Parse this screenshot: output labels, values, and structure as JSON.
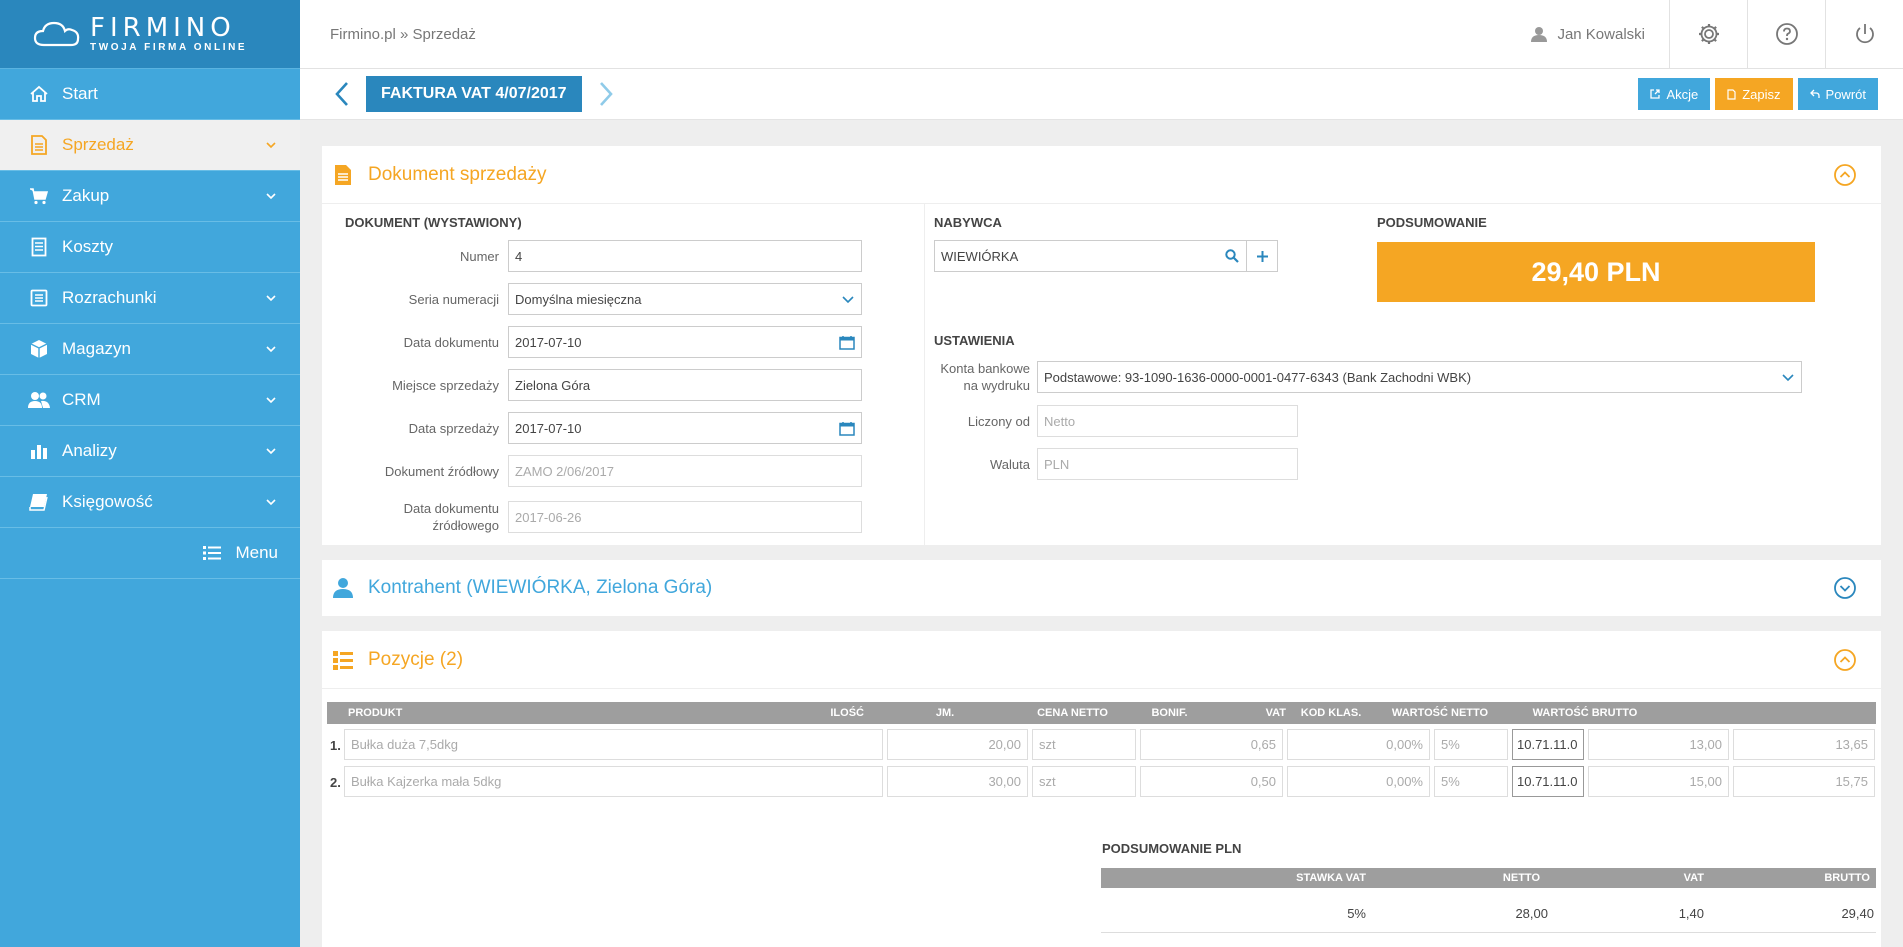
{
  "app": {
    "logo_name": "FIRMINO",
    "logo_tagline": "TWOJA FIRMA ONLINE"
  },
  "sidebar": {
    "items": [
      {
        "label": "Start",
        "icon": "home-icon"
      },
      {
        "label": "Sprzedaż",
        "icon": "document-icon",
        "active": true
      },
      {
        "label": "Zakup",
        "icon": "cart-icon"
      },
      {
        "label": "Koszty",
        "icon": "receipt-icon"
      },
      {
        "label": "Rozrachunki",
        "icon": "ledger-icon"
      },
      {
        "label": "Magazyn",
        "icon": "box-icon"
      },
      {
        "label": "CRM",
        "icon": "users-icon"
      },
      {
        "label": "Analizy",
        "icon": "bar-chart-icon"
      },
      {
        "label": "Księgowość",
        "icon": "book-icon"
      }
    ],
    "menu_label": "Menu"
  },
  "header": {
    "breadcrumb": "Firmino.pl » Sprzedaż",
    "user_name": "Jan Kowalski"
  },
  "titlebar": {
    "doc_title": "FAKTURA VAT 4/07/2017",
    "akcje": "Akcje",
    "zapisz": "Zapisz",
    "powrot": "Powrót"
  },
  "document_panel": {
    "title": "Dokument sprzedaży",
    "section_doc": "DOKUMENT (WYSTAWIONY)",
    "numer_label": "Numer",
    "numer_value": "4",
    "seria_label": "Seria numeracji",
    "seria_value": "Domyślna miesięczna",
    "data_dok_label": "Data dokumentu",
    "data_dok_value": "2017-07-10",
    "miejsce_label": "Miejsce sprzedaży",
    "miejsce_value": "Zielona Góra",
    "data_sprz_label": "Data sprzedaży",
    "data_sprz_value": "2017-07-10",
    "dok_zrodl_label": "Dokument źródłowy",
    "dok_zrodl_value": "ZAMO 2/06/2017",
    "data_zrodl_label1": "Data dokumentu",
    "data_zrodl_label2": "źródłowego",
    "data_zrodl_value": "2017-06-26",
    "section_nabywca": "NABYWCA",
    "nabywca_value": "WIEWIÓRKA",
    "section_summary": "PODSUMOWANIE",
    "summary_total": "29,40 PLN",
    "section_ustawienia": "USTAWIENIA",
    "konta_label1": "Konta bankowe",
    "konta_label2": "na wydruku",
    "konta_value": "Podstawowe: 93-1090-1636-0000-0001-0477-6343 (Bank Zachodni WBK)",
    "liczony_label": "Liczony od",
    "liczony_placeholder": "Netto",
    "waluta_label": "Waluta",
    "waluta_placeholder": "PLN"
  },
  "kontrahent_panel": {
    "title": "Kontrahent (WIEWIÓRKA, Zielona Góra)"
  },
  "pozycje_panel": {
    "title": "Pozycje (2)",
    "columns": [
      "PRODUKT",
      "ILOŚĆ",
      "JM.",
      "CENA NETTO",
      "BONIF.",
      "VAT",
      "KOD KLAS.",
      "WARTOŚĆ NETTO",
      "WARTOŚĆ BRUTTO"
    ],
    "rows": [
      {
        "num": "1.",
        "produkt": "Bułka duża 7,5dkg",
        "ilosc": "20,00",
        "jm": "szt",
        "cena": "0,65",
        "bonif": "0,00%",
        "vat": "5%",
        "kod": "10.71.11.0",
        "netto": "13,00",
        "brutto": "13,65"
      },
      {
        "num": "2.",
        "produkt": "Bułka Kajzerka mała 5dkg",
        "ilosc": "30,00",
        "jm": "szt",
        "cena": "0,50",
        "bonif": "0,00%",
        "vat": "5%",
        "kod": "10.71.11.0",
        "netto": "15,00",
        "brutto": "15,75"
      }
    ],
    "summary_title": "PODSUMOWANIE PLN",
    "summary_columns": [
      "STAWKA VAT",
      "NETTO",
      "VAT",
      "BRUTTO"
    ],
    "summary_rows": [
      {
        "stawka": "5%",
        "netto": "28,00",
        "vat": "1,40",
        "brutto": "29,40"
      }
    ]
  },
  "colors": {
    "sidebar": "#41a7dc",
    "logo_bg": "#2a87bd",
    "accent_orange": "#f5a623",
    "accent_blue": "#41a7dc"
  }
}
